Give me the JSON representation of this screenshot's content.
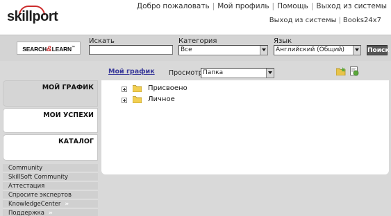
{
  "header": {
    "logo_text": "skillport",
    "top_links": [
      "Добро пожаловать",
      "Мой профиль",
      "Помощь",
      "Выход из системы"
    ],
    "logout_label": "Выход из системы",
    "books_label": "Books24x7"
  },
  "search": {
    "logo_text": "SEARCH & LEARN",
    "query_label": "Искать",
    "query_value": "",
    "category_label": "Категория",
    "category_value": "Все",
    "language_label": "Язык",
    "language_value": "Английский (Общий)",
    "button_label": "Поиск"
  },
  "content": {
    "link_label": "Мой график",
    "view_label": "Просмотр",
    "view_value": "Папка",
    "tree": [
      {
        "label": "Присвоено"
      },
      {
        "label": "Личное"
      }
    ]
  },
  "sidebar": {
    "blocks": [
      {
        "label": "МОЙ ГРАФИК",
        "active": true
      },
      {
        "label": "МОИ УСПЕХИ",
        "active": false
      },
      {
        "label": "КАТАЛОГ",
        "active": false
      }
    ],
    "links": [
      {
        "label": "Community"
      },
      {
        "label": "SkillSoft Community"
      },
      {
        "label": "Аттестация"
      },
      {
        "label": "Спросите экспертов"
      },
      {
        "label": "KnowledgeCenter"
      },
      {
        "label": "Поддержка"
      }
    ]
  },
  "colors": {
    "brand_red": "#cc2b2b",
    "link_blue": "#3a3a9a",
    "chrome_gray": "#d4d4d4"
  },
  "icons": [
    "plus-expander-icon",
    "folder-icon",
    "add-folder-icon",
    "settings-folder-icon",
    "chevron-right-icon",
    "dropdown-arrow-icon"
  ]
}
